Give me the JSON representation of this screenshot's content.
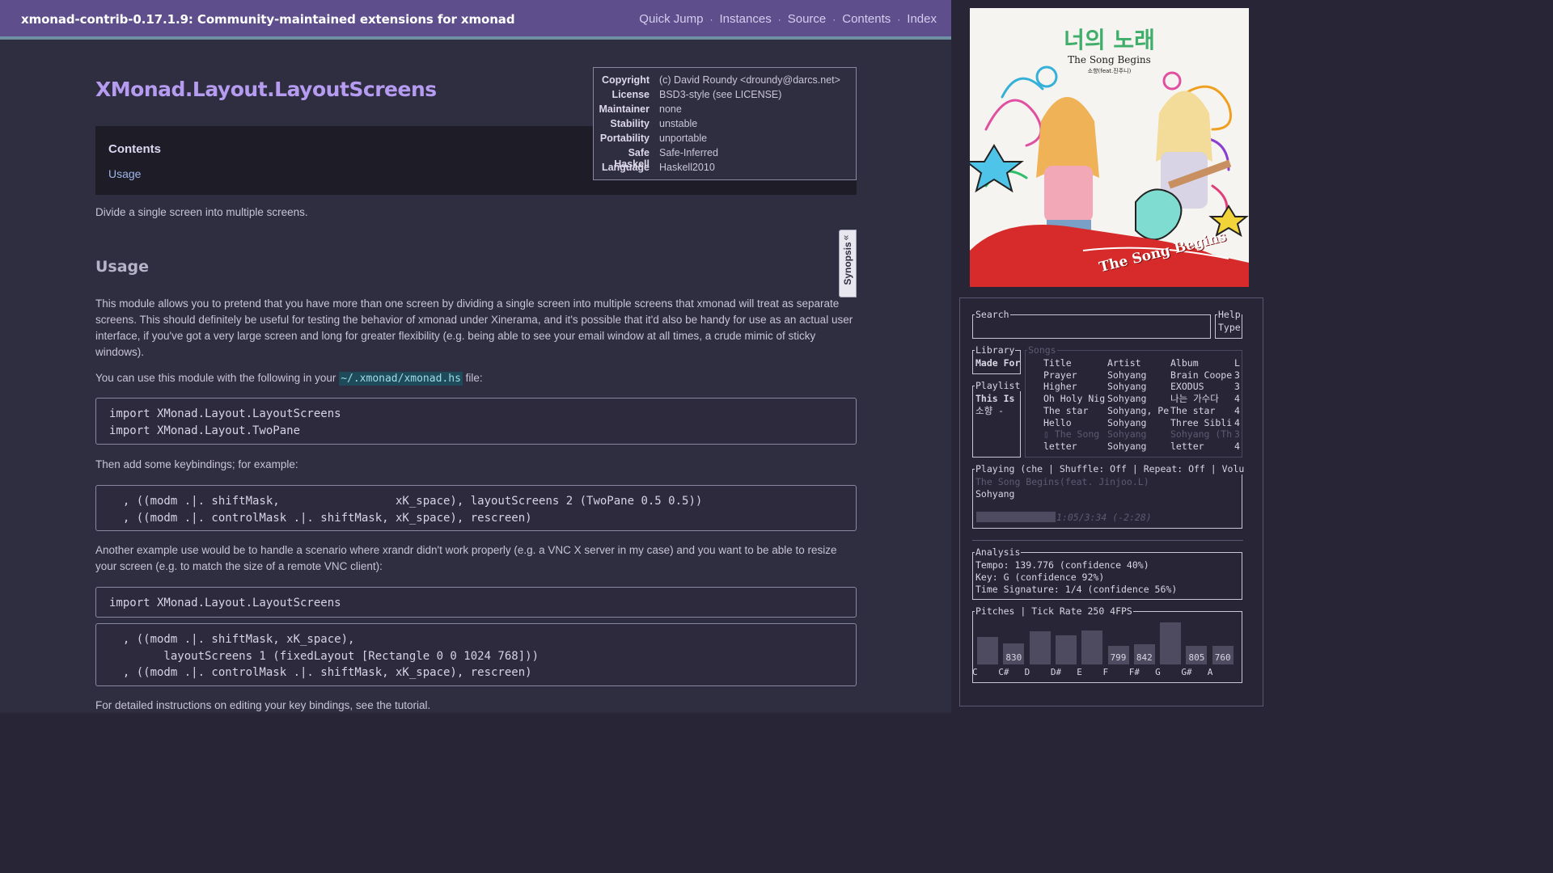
{
  "browser": {
    "package_title": "xmonad-contrib-0.17.1.9: Community-maintained extensions for xmonad",
    "nav": [
      "Quick Jump",
      "Instances",
      "Source",
      "Contents",
      "Index"
    ],
    "module_title": "XMonad.Layout.LayoutScreens",
    "contents": {
      "heading": "Contents",
      "link": "Usage"
    },
    "info": [
      {
        "key": "Copyright",
        "value": "(c) David Roundy <droundy@darcs.net>"
      },
      {
        "key": "License",
        "value": "BSD3-style (see LICENSE)"
      },
      {
        "key": "Maintainer",
        "value": "none"
      },
      {
        "key": "Stability",
        "value": "unstable"
      },
      {
        "key": "Portability",
        "value": "unportable"
      },
      {
        "key": "Safe Haskell",
        "value": "Safe-Inferred"
      },
      {
        "key": "Language",
        "value": "Haskell2010"
      }
    ],
    "synopsis_label": "Synopsis",
    "description": "Divide a single screen into multiple screens.",
    "usage_heading": "Usage",
    "p1": "This module allows you to pretend that you have more than one screen by dividing a single screen into multiple screens that xmonad will treat as separate screens. This should definitely be useful for testing the behavior of xmonad under Xinerama, and it's possible that it'd also be handy for use as an actual user interface, if you've got a very large screen and long for greater flexibility (e.g. being able to see your email window at all times, a crude mimic of sticky windows).",
    "p2_before": "You can use this module with the following in your ",
    "p2_code": "~/.xmonad/xmonad.hs",
    "p2_after": " file:",
    "code1": "import XMonad.Layout.LayoutScreens\nimport XMonad.Layout.TwoPane",
    "p3": "Then add some keybindings; for example:",
    "code2": "  , ((modm .|. shiftMask,                 xK_space), layoutScreens 2 (TwoPane 0.5 0.5))\n  , ((modm .|. controlMask .|. shiftMask, xK_space), rescreen)",
    "p4": "Another example use would be to handle a scenario where xrandr didn't work properly (e.g. a VNC X server in my case) and you want to be able to resize your screen (e.g. to match the size of a remote VNC client):",
    "code3": "import XMonad.Layout.LayoutScreens",
    "code4": "  , ((modm .|. shiftMask, xK_space),\n        layoutScreens 1 (fixedLayout [Rectangle 0 0 1024 768]))\n  , ((modm .|. controlMask .|. shiftMask, xK_space), rescreen)",
    "p5": "For detailed instructions on editing your key bindings, see the tutorial."
  },
  "player": {
    "album_art": {
      "title_korean": "너의 노래",
      "title_english": "The Song Begins",
      "subtitle": "소향(feat.진주니)",
      "banner": "The Song Begins"
    },
    "search": {
      "label": "Search",
      "value": ""
    },
    "help": {
      "label": "Help",
      "value": "Type"
    },
    "library": {
      "label": "Library",
      "item": "Made For"
    },
    "playlist": {
      "label": "Playlist",
      "items": [
        "This Is",
        "소향 -"
      ]
    },
    "songs": {
      "label": "Songs",
      "headers": [
        "Title",
        "Artist",
        "Album",
        "L"
      ],
      "rows": [
        [
          "Prayer",
          "Sohyang",
          "Brain Coope",
          "3"
        ],
        [
          "Higher",
          "Sohyang",
          "EXODUS",
          "3"
        ],
        [
          "Oh Holy Nig",
          "Sohyang",
          "나는 가수다",
          "4"
        ],
        [
          "The star",
          "Sohyang, Pe",
          "The star",
          "4"
        ],
        [
          "Hello",
          "Sohyang",
          "Three Sibli",
          "4"
        ],
        [
          "▯ The Song",
          "Sohyang",
          "Sohyang (Th",
          "3"
        ],
        [
          "letter",
          "Sohyang",
          "letter",
          "4"
        ]
      ],
      "playing_index": 5
    },
    "now_playing": {
      "label": "Playing (che | Shuffle: Off | Repeat: Off   | Volu",
      "track": "The Song Begins(feat. Jinjoo.L)",
      "artist": "Sohyang",
      "progress": 0.4,
      "time": "1:05/3:34 (-2:28)"
    },
    "analysis": {
      "label": "Analysis",
      "lines": [
        "Tempo: 139.776 (confidence 40%)",
        "Key: G (confidence 92%)",
        "Time Signature: 1/4 (confidence 56%)"
      ]
    },
    "pitches": {
      "label": "Pitches | Tick Rate 250 4FPS",
      "bars": [
        {
          "note": "C",
          "value": 0.52,
          "label": ""
        },
        {
          "note": "C#",
          "value": 0.4,
          "label": "830"
        },
        {
          "note": "D",
          "value": 0.63,
          "label": ""
        },
        {
          "note": "D#",
          "value": 0.55,
          "label": ""
        },
        {
          "note": "E",
          "value": 0.65,
          "label": ""
        },
        {
          "note": "F",
          "value": 0.36,
          "label": "799"
        },
        {
          "note": "F#",
          "value": 0.38,
          "label": "842"
        },
        {
          "note": "G",
          "value": 0.8,
          "label": ""
        },
        {
          "note": "G#",
          "value": 0.36,
          "label": "805"
        },
        {
          "note": "A",
          "value": 0.36,
          "label": "760"
        }
      ]
    }
  }
}
